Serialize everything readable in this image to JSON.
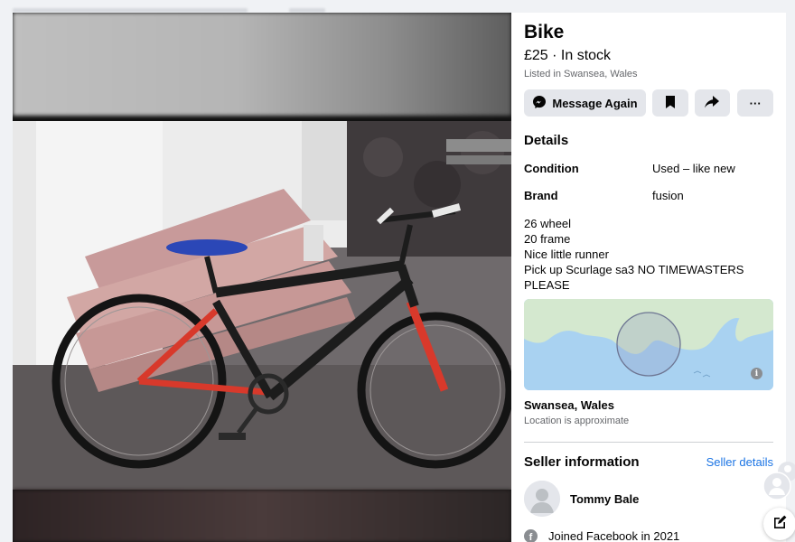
{
  "listing": {
    "title": "Bike",
    "price_line": "£25 · In stock",
    "listed_in": "Listed in Swansea, Wales"
  },
  "actions": {
    "message_label": "Message Again",
    "save_icon": "bookmark-icon",
    "share_icon": "share-icon",
    "more_label": "···"
  },
  "details": {
    "heading": "Details",
    "rows": [
      {
        "key": "Condition",
        "value": "Used – like new"
      },
      {
        "key": "Brand",
        "value": "fusion"
      }
    ],
    "description": [
      "26 wheel",
      "20 frame",
      "Nice little runner",
      "Pick up Scurlage sa3 NO TIMEWASTERS",
      "PLEASE"
    ]
  },
  "location": {
    "name": "Swansea, Wales",
    "note": "Location is approximate",
    "info_glyph": "i"
  },
  "seller": {
    "heading": "Seller information",
    "details_link": "Seller details",
    "name": "Tommy Bale",
    "joined": "Joined Facebook in 2021",
    "fb_glyph": "f"
  },
  "colors": {
    "accent": "#1b74e4",
    "button_bg": "#e4e6eb",
    "map_sea": "#a9d2f1",
    "map_land": "#d4e8cf"
  }
}
